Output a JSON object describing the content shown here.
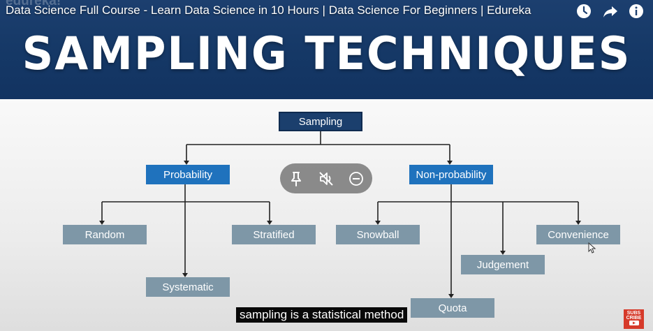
{
  "video": {
    "title": "Data Science Full Course - Learn Data Science in 10 Hours | Data Science For Beginners | Edureka",
    "watermark": "edureka!",
    "icons": [
      "watch-later-icon",
      "share-icon",
      "info-icon"
    ]
  },
  "slide": {
    "title": "SAMPLING TECHNIQUES",
    "root": "Sampling",
    "probability": {
      "label": "Probability",
      "children": [
        "Random",
        "Systematic",
        "Stratified"
      ]
    },
    "non_probability": {
      "label": "Non-probability",
      "children": [
        "Snowball",
        "Quota",
        "Judgement",
        "Convenience"
      ]
    }
  },
  "player_controls": [
    "pin-icon",
    "mute-icon",
    "minus-circle-icon"
  ],
  "caption": "sampling is a statistical method",
  "subscribe_badge": {
    "line1": "SUBS",
    "line2": "CRIBE"
  },
  "colors": {
    "banner": "#153866",
    "root_node": "#1b3f6d",
    "category_node": "#1f72bd",
    "leaf_node": "#7e97a7"
  }
}
